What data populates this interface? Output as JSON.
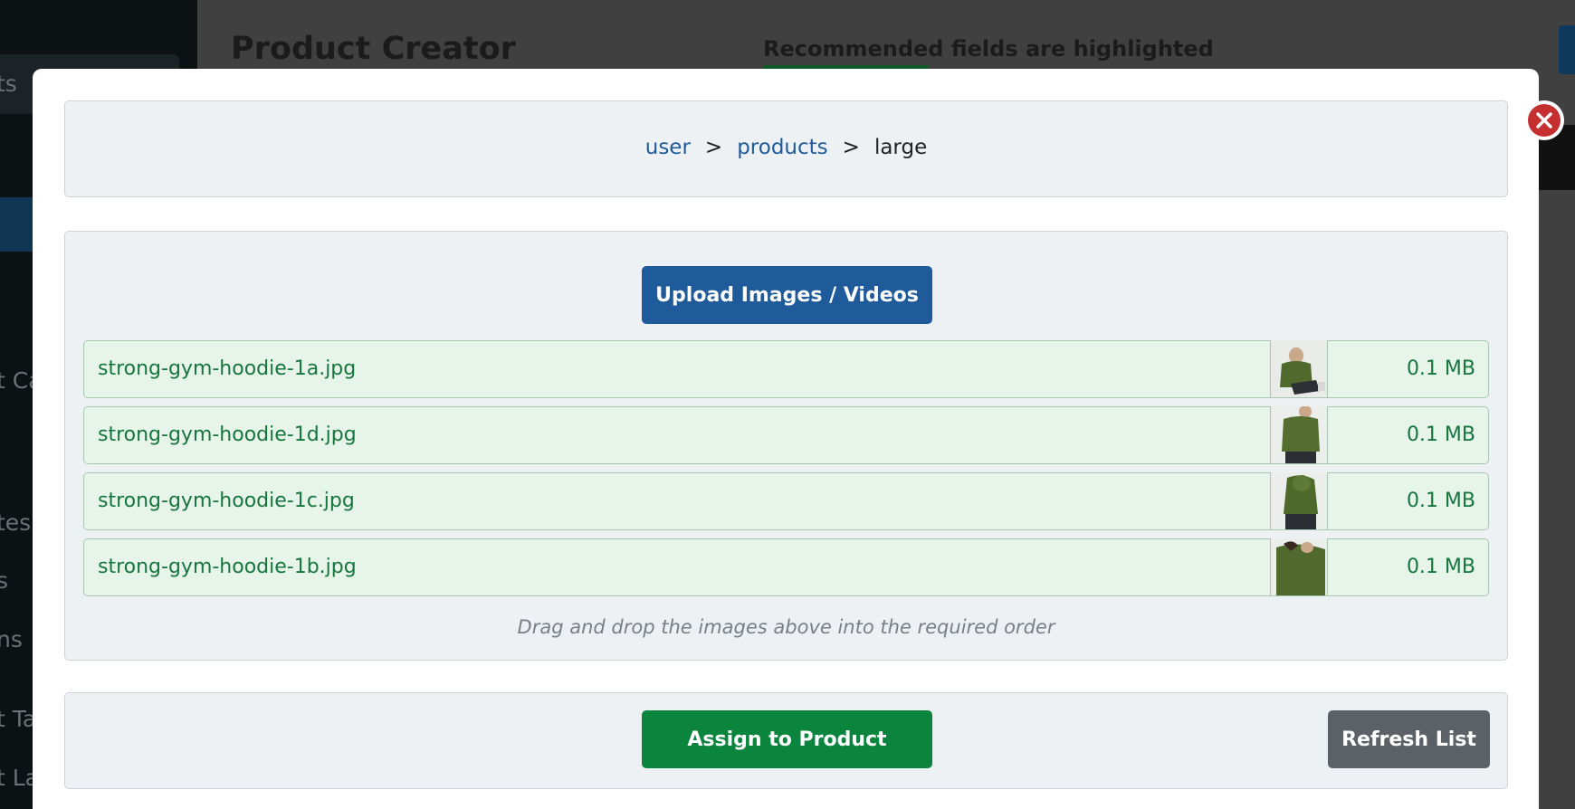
{
  "background": {
    "page_title": "Product Creator",
    "header_hint": "Recommended fields are highlighted",
    "sidebar_fragments": [
      "ts",
      "t Ca",
      "tes",
      "s",
      "ns",
      "t Ta",
      "t La"
    ]
  },
  "modal": {
    "breadcrumb": {
      "items": [
        "user",
        "products",
        "large"
      ],
      "separator": ">"
    },
    "upload_button_label": "Upload Images / Videos",
    "files": [
      {
        "name": "strong-gym-hoodie-1a.jpg",
        "size": "0.1 MB"
      },
      {
        "name": "strong-gym-hoodie-1d.jpg",
        "size": "0.1 MB"
      },
      {
        "name": "strong-gym-hoodie-1c.jpg",
        "size": "0.1 MB"
      },
      {
        "name": "strong-gym-hoodie-1b.jpg",
        "size": "0.1 MB"
      }
    ],
    "drag_hint": "Drag and drop the images above into the required order",
    "assign_button_label": "Assign to Product",
    "refresh_button_label": "Refresh List",
    "close_icon": "close-icon"
  },
  "colors": {
    "primary_blue": "#1f5a9a",
    "success_green": "#0b853e",
    "secondary_gray": "#5b6167",
    "danger_red": "#c62f2f",
    "file_row_bg": "#e6f4ea",
    "file_text": "#17763e"
  }
}
